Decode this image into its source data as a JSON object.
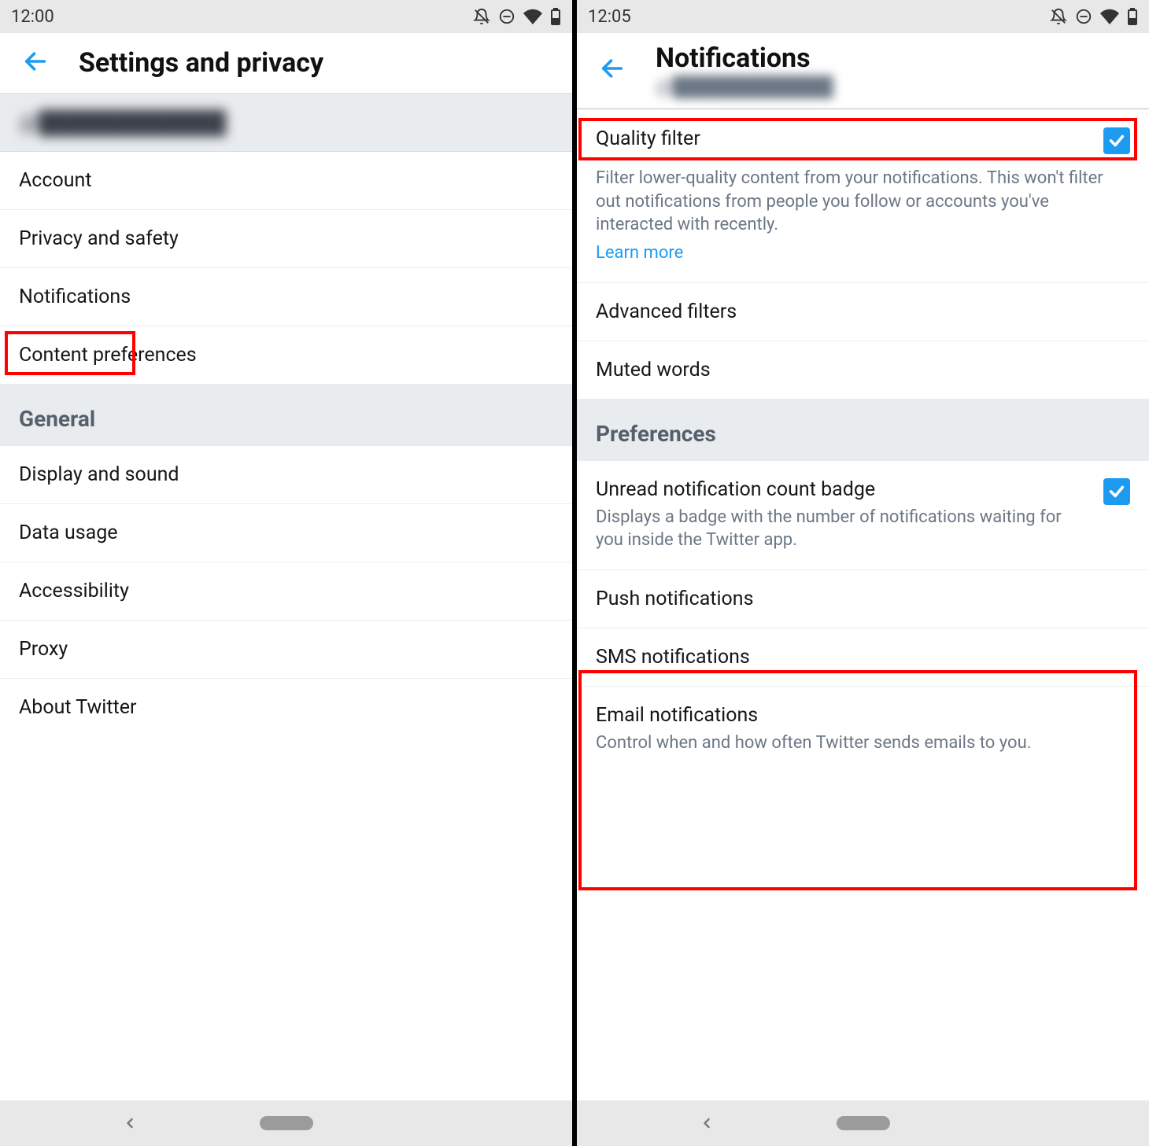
{
  "left": {
    "status_time": "12:00",
    "title": "Settings and privacy",
    "account_handle": "@████████████",
    "rows": {
      "account": "Account",
      "privacy": "Privacy and safety",
      "notifications": "Notifications",
      "content_prefs": "Content preferences"
    },
    "section_general": "General",
    "general_rows": {
      "display": "Display and sound",
      "data": "Data usage",
      "accessibility": "Accessibility",
      "proxy": "Proxy",
      "about": "About Twitter"
    }
  },
  "right": {
    "status_time": "12:05",
    "title": "Notifications",
    "subtitle_handle": "@████████████",
    "quality_filter": {
      "label": "Quality filter",
      "desc": "Filter lower-quality content from your notifications. This won't filter out notifications from people you follow or accounts you've interacted with recently.",
      "learn_more": "Learn more",
      "checked": true
    },
    "advanced_filters": "Advanced filters",
    "muted_words": "Muted words",
    "section_preferences": "Preferences",
    "unread_badge": {
      "label": "Unread notification count badge",
      "desc": "Displays a badge with the number of notifications waiting for you inside the Twitter app.",
      "checked": true
    },
    "push": "Push notifications",
    "sms": "SMS notifications",
    "email": {
      "label": "Email notifications",
      "desc": "Control when and how often Twitter sends emails to you."
    }
  }
}
